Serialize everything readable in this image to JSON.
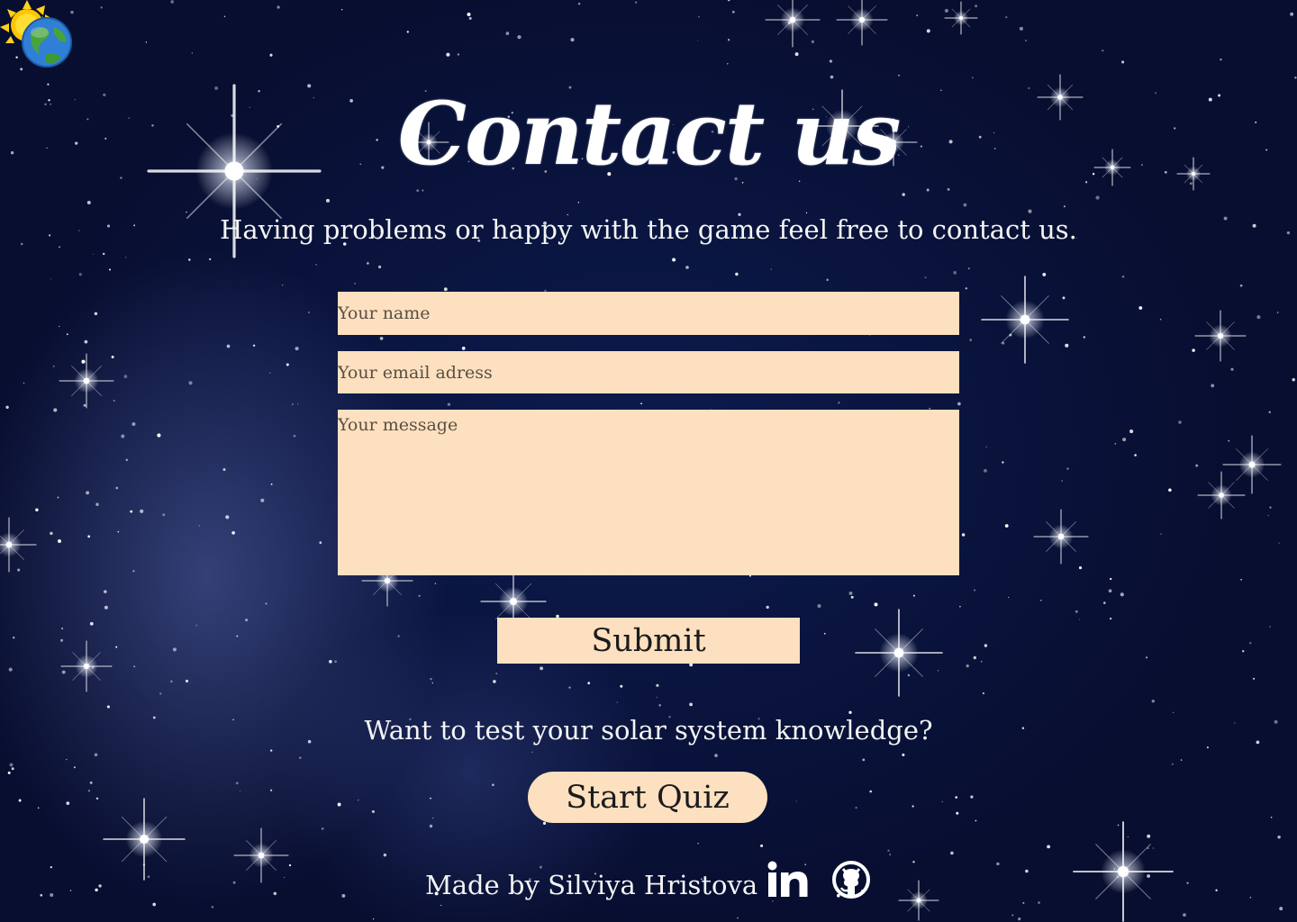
{
  "page": {
    "title": "Contact us",
    "subtitle": "Having problems or happy with the game feel free to contact us."
  },
  "form": {
    "name_placeholder": "Your name",
    "email_placeholder": "Your email adress",
    "message_placeholder": "Your message",
    "submit_label": "Submit"
  },
  "quiz": {
    "prompt": "Want to test your solar system knowledge?",
    "button_label": "Start Quiz"
  },
  "footer": {
    "credit": "Made by Silviya Hristova",
    "links": [
      "linkedin-icon",
      "github-icon"
    ]
  },
  "colors": {
    "field_bg": "#fde0bf",
    "sky_deep": "#070e30",
    "sky_mid": "#0d1b4e",
    "text": "#ffffff"
  },
  "icons": {
    "logo": "sun-earth-icon"
  }
}
